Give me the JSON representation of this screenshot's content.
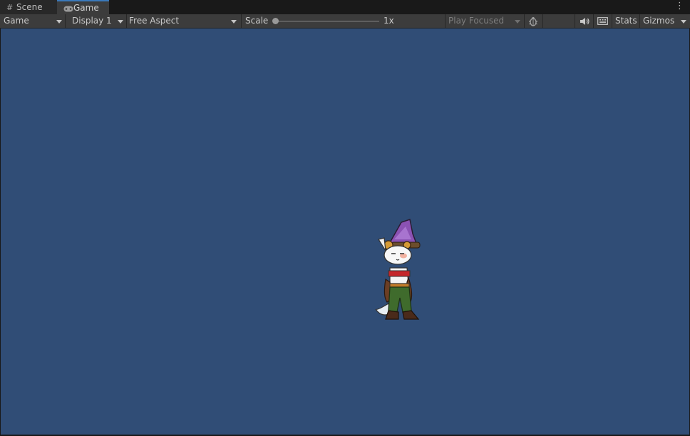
{
  "tabs": [
    {
      "label": "Scene",
      "icon": "grid-icon",
      "active": false
    },
    {
      "label": "Game",
      "icon": "gamepad-icon",
      "active": true
    }
  ],
  "toolbar": {
    "view_mode": "Game",
    "display": "Display 1",
    "aspect": "Free Aspect",
    "scale_label": "Scale",
    "scale_value": "1x",
    "play_mode": "Play Focused",
    "stats_label": "Stats",
    "gizmos_label": "Gizmos"
  },
  "colors": {
    "viewport_background": "#304d76",
    "active_tab_accent": "#3a79bb"
  }
}
